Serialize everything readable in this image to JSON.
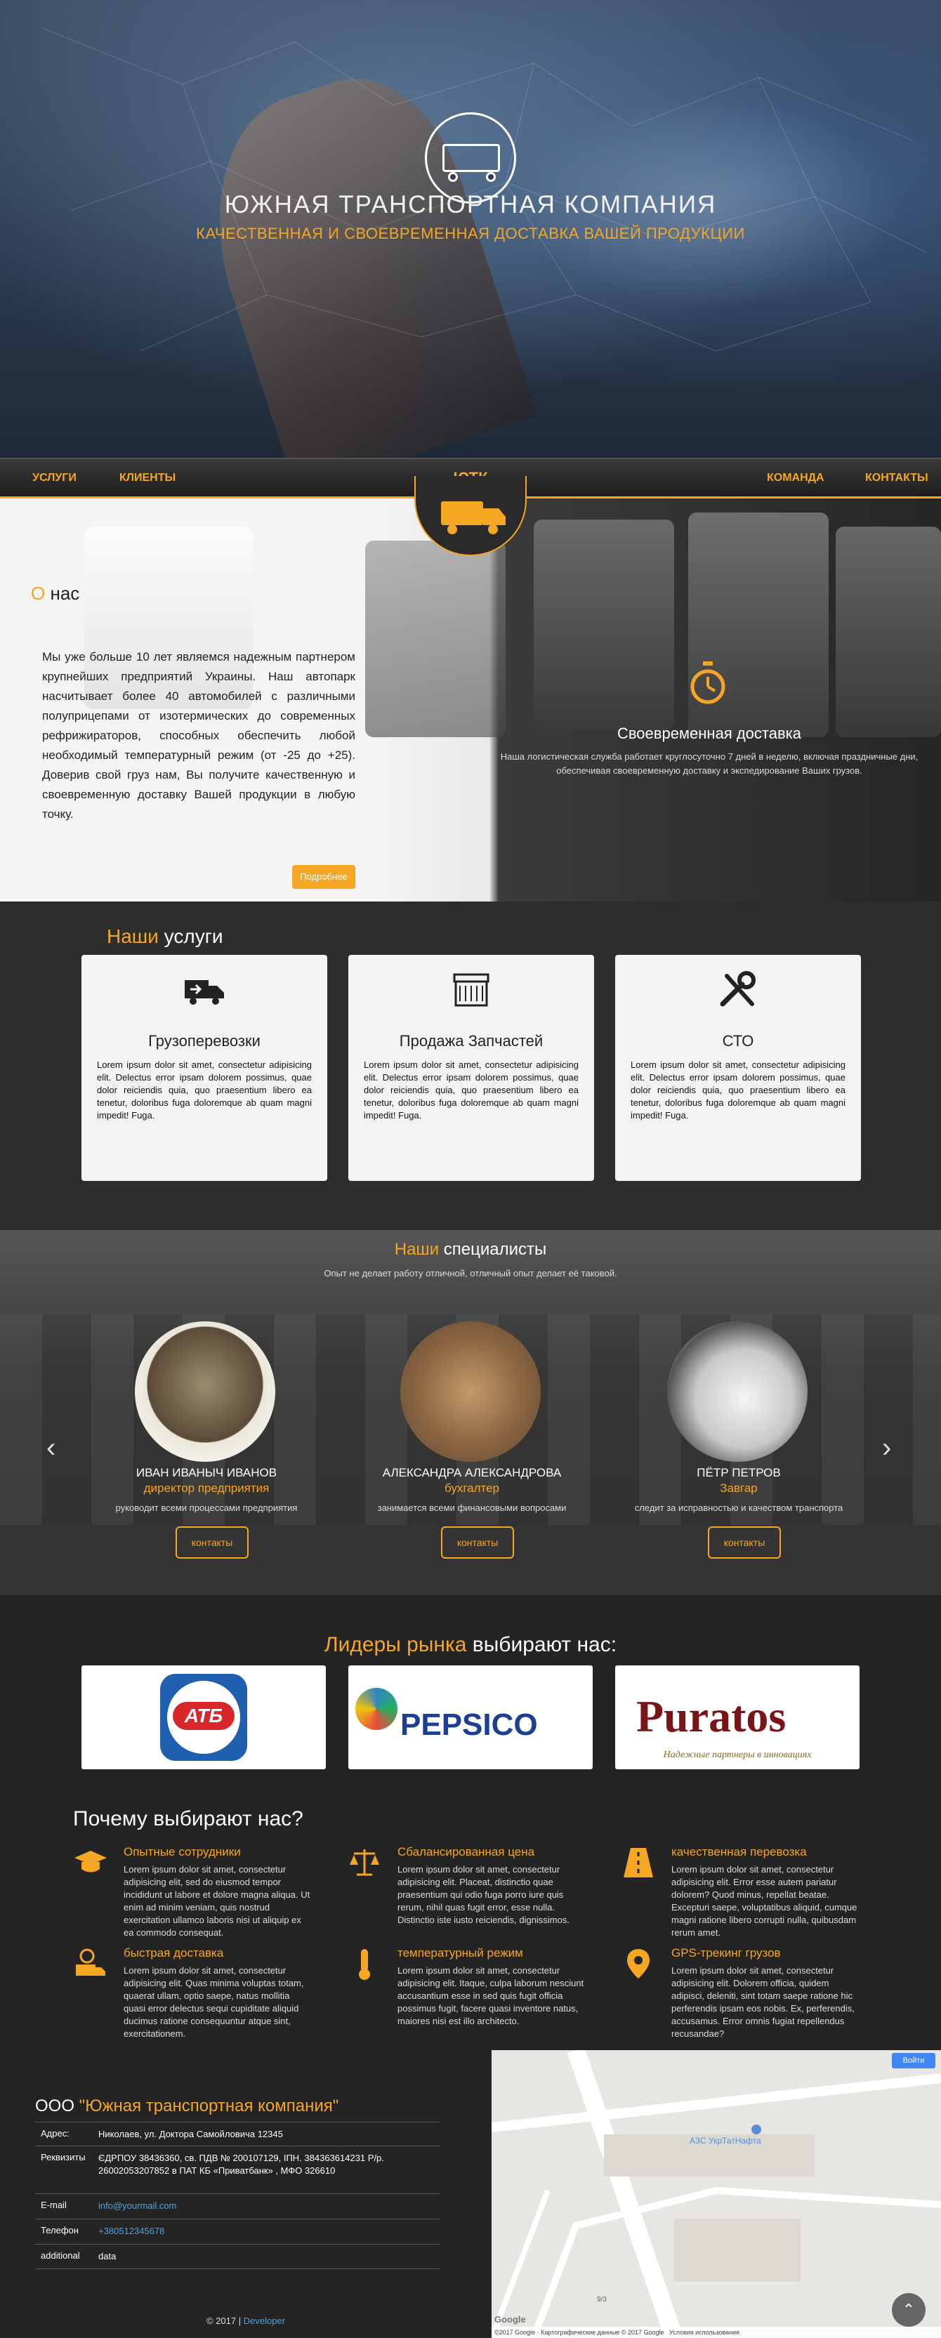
{
  "hero": {
    "title": "ЮЖНАЯ ТРАНСПОРТНАЯ КОМПАНИЯ",
    "subtitle": "КАЧЕСТВЕННАЯ И СВОЕВРЕМЕННАЯ ДОСТАВКА ВАШЕЙ ПРОДУКЦИИ"
  },
  "nav": {
    "brand": "ЮТК",
    "items": [
      "УСЛУГИ",
      "КЛИЕНТЫ",
      "КОМАНДА",
      "КОНТАКТЫ"
    ]
  },
  "about": {
    "heading_first": "О",
    "heading_rest": " нас",
    "text": "Мы уже больше 10 лет являемся надежным партнером крупнейших предприятий Украины. Наш автопарк насчитывает более 40 автомобилей с различными полуприцепами от изотермических до современных рефрижираторов, способных обеспечить любой необходимый температурный режим (от -25 до +25). Доверив свой груз нам, Вы получите качественную и своевременную доставку Вашей продукции в любую точку.",
    "button": "Подробнее",
    "feature_title": "Своевременная доставка",
    "feature_text": "Наша логистическая служба работает круглосуточно 7 дней в неделю, включая праздничные дни, обеспечивая своевременную доставку и экспедирование Ваших грузов."
  },
  "services": {
    "head_y": "Наши",
    "head_rest": " услуги",
    "items": [
      {
        "title": "Грузоперевозки",
        "text": "Lorem ipsum dolor sit amet, consectetur adipisicing elit. Delectus error ipsam dolorem possimus, quae dolor reiciendis quia, quo praesentium libero ea tenetur, doloribus fuga doloremque ab quam magni impedit! Fuga."
      },
      {
        "title": "Продажа Запчастей",
        "text": "Lorem ipsum dolor sit amet, consectetur adipisicing elit. Delectus error ipsam dolorem possimus, quae dolor reiciendis quia, quo praesentium libero ea tenetur, doloribus fuga doloremque ab quam magni impedit! Fuga."
      },
      {
        "title": "СТО",
        "text": "Lorem ipsum dolor sit amet, consectetur adipisicing elit. Delectus error ipsam dolorem possimus, quae dolor reiciendis quia, quo praesentium libero ea tenetur, doloribus fuga doloremque ab quam magni impedit! Fuga."
      }
    ]
  },
  "team": {
    "head_y": "Наши",
    "head_rest": " специалисты",
    "subtitle": "Опыт не делает работу отличной, отличный опыт делает её таковой.",
    "members": [
      {
        "name": "ИВАН ИВАНЫЧ ИВАНОВ",
        "role": "директор предприятия",
        "desc": "руководит всеми процессами предприятия",
        "button": "контакты"
      },
      {
        "name": "АЛЕКСАНДРА АЛЕКСАНДРОВА",
        "role": "бухгалтер",
        "desc": "занимается всеми финансовыми вопросами",
        "button": "контакты"
      },
      {
        "name": "ПЁТР ПЕТРОВ",
        "role": "Завгар",
        "desc": "следит за исправностью и качеством транспорта",
        "button": "контакты"
      }
    ]
  },
  "partners": {
    "head_y": "Лидеры рынка",
    "head_rest": " выбирают нас:",
    "logos": [
      "АТБ",
      "PEPSICO",
      "Puratos",
      "Надежные партнеры в инновациях"
    ]
  },
  "why": {
    "heading": "Почему выбирают нас?",
    "items": [
      {
        "title": "Опытные сотрудники",
        "text": "Lorem ipsum dolor sit amet, consectetur adipisicing elit, sed do eiusmod tempor incididunt ut labore et dolore magna aliqua. Ut enim ad minim veniam, quis nostrud exercitation ullamco laboris nisi ut aliquip ex ea commodo consequat."
      },
      {
        "title": "Сбалансированная цена",
        "text": "Lorem ipsum dolor sit amet, consectetur adipisicing elit. Placeat, distinctio quae praesentium qui odio fuga porro iure quis rerum, nihil quas fugit error, esse nulla. Distinctio iste iusto reiciendis, dignissimos."
      },
      {
        "title": "качественная перевозка",
        "text": "Lorem ipsum dolor sit amet, consectetur adipisicing elit. Error esse autem pariatur dolorem? Quod minus, repellat beatae. Excepturi saepe, voluptatibus aliquid, cumque magni ratione libero corrupti nulla, quibusdam rerum amet."
      },
      {
        "title": "быстрая доставка",
        "text": "Lorem ipsum dolor sit amet, consectetur adipisicing elit. Quas minima voluptas totam, quaerat ullam, optio saepe, natus mollitia quasi error delectus sequi cupiditate aliquid ducimus ratione consequuntur atque sint, exercitationem."
      },
      {
        "title": "температурный режим",
        "text": "Lorem ipsum dolor sit amet, consectetur adipisicing elit. Itaque, culpa laborum nesciunt accusantium esse in sed quis fugit officia possimus fugit, facere quasi inventore natus, maiores nisi est illo architecto."
      },
      {
        "title": "GPS-трекинг грузов",
        "text": "Lorem ipsum dolor sit amet, consectetur adipisicing elit. Dolorem officia, quidem adipisci, deleniti, sint totam saepe ratione hic perferendis ipsam eos nobis. Ex, perferendis, accusamus. Error omnis fugiat repellendus recusandae?"
      }
    ]
  },
  "contact": {
    "head_white": "ООО ",
    "head_y": "\"Южная транспортная компания\"",
    "rows": [
      {
        "key": "Адрес:",
        "value": "Николаев, ул. Доктора Самойловича 12345"
      },
      {
        "key": "Реквизиты",
        "value": "ЄДРПОУ 38436360, св. ПДВ № 200107129, ІПН. 384363614231 Р/р. 26002053207852 в ПАТ КБ «Приватбанк» , МФО 326610"
      },
      {
        "key": "E-mail",
        "value": "info@yourmail.com"
      },
      {
        "key": "Телефон",
        "value": "+380512345678"
      },
      {
        "key": "additional",
        "value": "data"
      }
    ]
  },
  "map": {
    "label": "АЗС УкрТатНафта",
    "login": "Войти",
    "google": "Google",
    "copyright": "©2017 Google · Картографические данные © 2017 Google",
    "terms": "Условия использования",
    "house": "9/3"
  },
  "footer": {
    "prefix": "© 2017 | ",
    "link": "Developer"
  },
  "colors": {
    "accent": "#f5a623",
    "dark": "#2b2b2b"
  }
}
